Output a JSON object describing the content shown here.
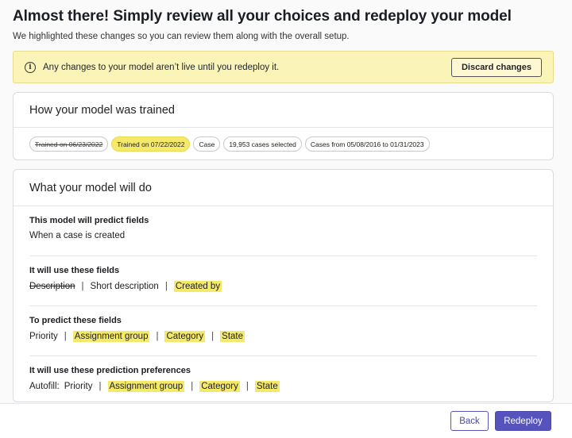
{
  "header": {
    "title": "Almost there! Simply review all your choices and redeploy your model",
    "subtitle": "We highlighted these changes so you can review them along with the overall setup."
  },
  "alert": {
    "icon": "info-icon",
    "text": "Any changes to your model aren’t live until you redeploy it.",
    "discard_label": "Discard changes"
  },
  "training": {
    "heading": "How your model was trained",
    "chips": [
      {
        "label": "Trained on 06/23/2022",
        "state": "removed"
      },
      {
        "label": "Trained on 07/22/2022",
        "state": "added"
      },
      {
        "label": "Case",
        "state": "unchanged"
      },
      {
        "label": "19,953 cases selected",
        "state": "unchanged"
      },
      {
        "label": "Cases from 05/08/2016 to 01/31/2023",
        "state": "unchanged"
      }
    ]
  },
  "will_do": {
    "heading": "What your model will do",
    "predict": {
      "title": "This model will predict fields",
      "value": "When a case is created"
    },
    "use_fields": {
      "title": "It will use these fields",
      "items": [
        {
          "label": "Description",
          "state": "removed"
        },
        {
          "label": "Short description",
          "state": "unchanged"
        },
        {
          "label": "Created by",
          "state": "added"
        }
      ]
    },
    "predict_fields": {
      "title": "To predict these fields",
      "items": [
        {
          "label": "Priority",
          "state": "unchanged"
        },
        {
          "label": "Assignment group",
          "state": "added"
        },
        {
          "label": "Category",
          "state": "added"
        },
        {
          "label": "State",
          "state": "added"
        }
      ]
    },
    "preferences": {
      "title": "It will use these prediction preferences",
      "prefix": "Autofill:",
      "items": [
        {
          "label": "Priority",
          "state": "unchanged"
        },
        {
          "label": "Assignment group",
          "state": "added"
        },
        {
          "label": "Category",
          "state": "added"
        },
        {
          "label": "State",
          "state": "added"
        }
      ]
    }
  },
  "footer": {
    "back_label": "Back",
    "redeploy_label": "Redeploy"
  },
  "colors": {
    "highlight": "#f5e96a",
    "alert_bg": "#fbf4b9",
    "primary": "#5653bd"
  }
}
